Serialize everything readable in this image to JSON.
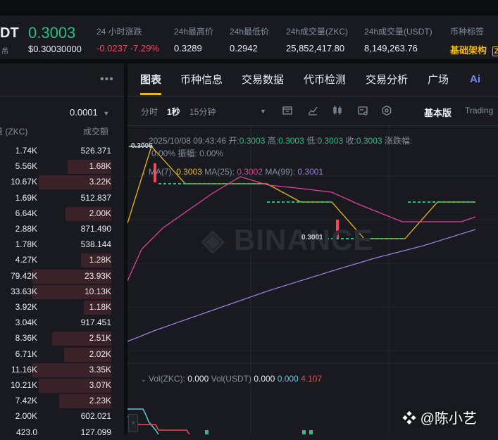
{
  "ticker": {
    "symbol": "DT",
    "symbol_sub": "吊",
    "last_price": "0.3003",
    "last_price_usd": "$0.30030000",
    "change_label": "24 小时涨跌",
    "change_value": "-0.0237 -7.29%",
    "high_label": "24h最高价",
    "high_value": "0.3289",
    "low_label": "24h最低价",
    "low_value": "0.2942",
    "vol_base_label": "24h成交量(ZKC)",
    "vol_base_value": "25,852,417.80",
    "vol_quote_label": "24h成交量(USDT)",
    "vol_quote_value": "8,149,263.76",
    "tag_label": "币种标签",
    "tag_value": "基础架构",
    "tag_extra": "Z"
  },
  "orderbook": {
    "menu_icon": "more-dots-icon",
    "precision": "0.0001",
    "col_qty": "数量 (ZKC)",
    "col_amount": "成交额",
    "rows": [
      {
        "qty": "1.74K",
        "amount": "526.371",
        "depth": 0.0
      },
      {
        "qty": "5.56K",
        "amount": "1.68K",
        "depth": 0.55
      },
      {
        "qty": "10.67K",
        "amount": "3.22K",
        "depth": 0.92
      },
      {
        "qty": "1.69K",
        "amount": "512.837",
        "depth": 0.0
      },
      {
        "qty": "6.64K",
        "amount": "2.00K",
        "depth": 0.58
      },
      {
        "qty": "2.88K",
        "amount": "871.490",
        "depth": 0.0
      },
      {
        "qty": "1.78K",
        "amount": "538.144",
        "depth": 0.0
      },
      {
        "qty": "4.27K",
        "amount": "1.28K",
        "depth": 0.38
      },
      {
        "qty": "79.42K",
        "amount": "23.93K",
        "depth": 1.0
      },
      {
        "qty": "33.63K",
        "amount": "10.13K",
        "depth": 1.0
      },
      {
        "qty": "3.92K",
        "amount": "1.18K",
        "depth": 0.35
      },
      {
        "qty": "3.04K",
        "amount": "917.451",
        "depth": 0.0
      },
      {
        "qty": "8.36K",
        "amount": "2.51K",
        "depth": 0.75
      },
      {
        "qty": "6.71K",
        "amount": "2.02K",
        "depth": 0.6
      },
      {
        "qty": "11.16K",
        "amount": "3.35K",
        "depth": 1.0
      },
      {
        "qty": "10.21K",
        "amount": "3.07K",
        "depth": 0.92
      },
      {
        "qty": "7.42K",
        "amount": "2.23K",
        "depth": 0.66
      },
      {
        "qty": "2.00K",
        "amount": "602.021",
        "depth": 0.0
      },
      {
        "qty": "423.0",
        "amount": "127.099",
        "depth": 0.0
      }
    ]
  },
  "tabs": [
    "图表",
    "币种信息",
    "交易数据",
    "代币检测",
    "交易分析",
    "广场"
  ],
  "ai_label": "Ai",
  "toolbar": {
    "interval_time": "分时",
    "interval_1s": "1秒",
    "interval_15m": "15分钟",
    "mode_basic": "基本版",
    "mode_trading": "Trading"
  },
  "legend": {
    "datetime": "2025/10/08 09:43:46",
    "open_label": "开:",
    "open": "0.3003",
    "high_label": "高:",
    "high": "0.3003",
    "low_label": "低:",
    "low": "0.3003",
    "close_label": "收:",
    "close": "0.3003",
    "chg_label": "涨跌幅:",
    "chg": "0.00%",
    "amp_label": "振幅:",
    "amp": "0.00%",
    "ma7_label": "MA(7):",
    "ma7": "0.3003",
    "ma25_label": "MA(25):",
    "ma25": "0.3002",
    "ma99_label": "MA(99):",
    "ma99": "0.3001",
    "vol_label": "Vol(ZKC):",
    "vol": "0.000",
    "volq_label": "Vol(USDT)",
    "volq": "0.000",
    "volq_ma1": "0.000",
    "volq_ma2": "4.107"
  },
  "price_tags": {
    "high": "0.3006",
    "low": "0.3001"
  },
  "watermark": "BINANCE",
  "credit": "@陈小艺",
  "colors": {
    "up": "#2ebd85",
    "down": "#f6465d",
    "accent": "#f0b90b",
    "ma7": "#f0b90b",
    "ma25": "#e0409a",
    "ma99": "#9a7ce0"
  }
}
